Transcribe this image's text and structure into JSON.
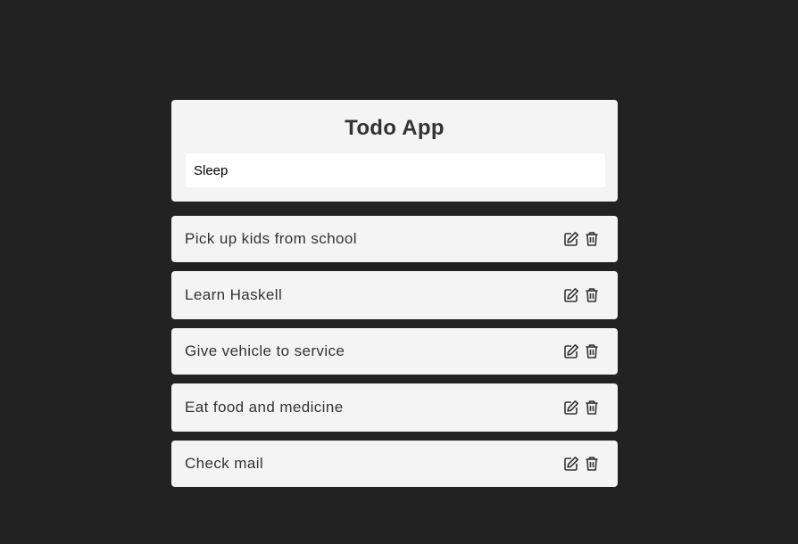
{
  "app": {
    "title": "Todo App"
  },
  "new_todo_input": {
    "value": "Sleep",
    "placeholder": ""
  },
  "todos": [
    {
      "text": "Pick up kids from school"
    },
    {
      "text": "Learn Haskell"
    },
    {
      "text": "Give vehicle to service"
    },
    {
      "text": "Eat food and medicine"
    },
    {
      "text": "Check mail"
    }
  ],
  "icons": {
    "edit": "edit-icon",
    "delete": "trash-icon"
  },
  "colors": {
    "background": "#222222",
    "card": "#f4f4f4",
    "text": "#333333"
  }
}
